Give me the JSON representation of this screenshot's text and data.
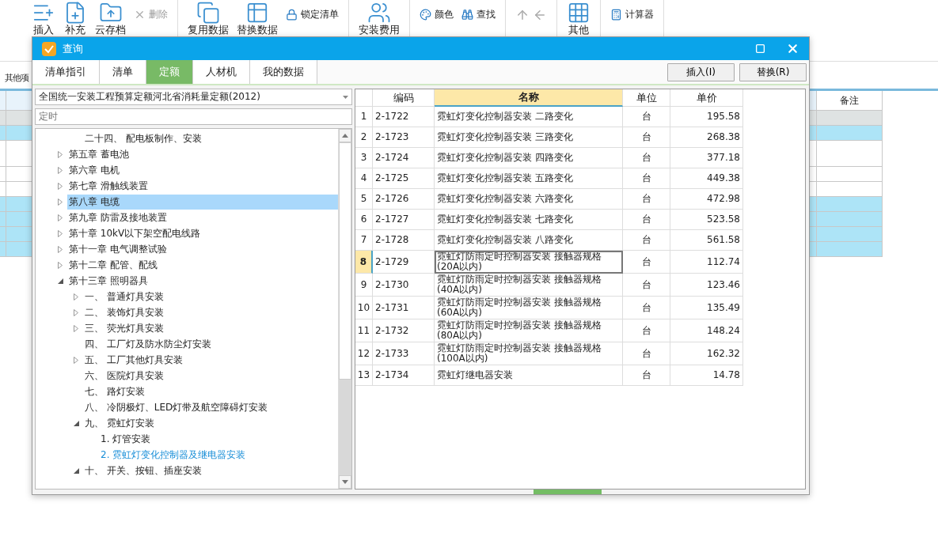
{
  "toolbar": {
    "groups": [
      {
        "items": [
          {
            "kind": "large",
            "label": "插入"
          },
          {
            "kind": "large",
            "label": "补充"
          },
          {
            "kind": "large",
            "label": "云存档"
          },
          {
            "kind": "small",
            "label": "删除",
            "disabled": true
          }
        ]
      },
      {
        "items": [
          {
            "kind": "large",
            "label": "复用数据"
          },
          {
            "kind": "large",
            "label": "替换数据"
          },
          {
            "kind": "small",
            "label": "锁定清单",
            "disabled": false
          }
        ]
      },
      {
        "items": [
          {
            "kind": "large",
            "label": "安装费用"
          }
        ]
      },
      {
        "items": [
          {
            "kind": "small",
            "label": "颜色",
            "disabled": false
          },
          {
            "kind": "small",
            "label": "查找",
            "disabled": false
          }
        ]
      },
      {
        "items": [
          {
            "kind": "arrows"
          }
        ]
      },
      {
        "items": [
          {
            "kind": "large",
            "label": "其他"
          }
        ]
      },
      {
        "items": [
          {
            "kind": "small",
            "label": "计算器",
            "disabled": false
          }
        ]
      }
    ]
  },
  "sheet": {
    "tab": "其他项",
    "column": "备注",
    "rows": [
      {
        "kind": "grey"
      },
      {
        "kind": "blue"
      },
      {
        "kind": "tall"
      },
      {
        "kind": "white"
      },
      {
        "kind": "white"
      },
      {
        "kind": "blue"
      },
      {
        "kind": "blue"
      },
      {
        "kind": "blue"
      },
      {
        "kind": "blue"
      }
    ]
  },
  "dialog": {
    "title": "查询",
    "tabs": [
      {
        "label": "清单指引",
        "selected": false
      },
      {
        "label": "清单",
        "selected": false
      },
      {
        "label": "定额",
        "selected": true
      },
      {
        "label": "人材机",
        "selected": false
      },
      {
        "label": "我的数据",
        "selected": false
      }
    ],
    "buttons": [
      "插入(I)",
      "替换(R)"
    ],
    "library": "全国统一安装工程预算定额河北省消耗量定额(2012)",
    "search": {
      "value": "定时"
    },
    "tree": [
      {
        "children": [
          {
            "label": "二十四、 配电板制作、安装",
            "kind": "leaf",
            "selected": false,
            "active": false
          }
        ]
      },
      {
        "label": "第五章 蓄电池",
        "kind": "branch",
        "expanded": false,
        "selected": false,
        "active": false
      },
      {
        "label": "第六章 电机",
        "kind": "branch",
        "expanded": false,
        "selected": false,
        "active": false
      },
      {
        "label": "第七章 滑触线装置",
        "kind": "branch",
        "expanded": false,
        "selected": false,
        "active": false
      },
      {
        "label": "第八章 电缆",
        "kind": "branch",
        "expanded": false,
        "selected": true,
        "active": false
      },
      {
        "label": "第九章 防雷及接地装置",
        "kind": "branch",
        "expanded": false,
        "selected": false,
        "active": false
      },
      {
        "label": "第十章 10kV以下架空配电线路",
        "kind": "branch",
        "expanded": false,
        "selected": false,
        "active": false
      },
      {
        "label": "第十一章 电气调整试验",
        "kind": "branch",
        "expanded": false,
        "selected": false,
        "active": false
      },
      {
        "label": "第十二章 配管、配线",
        "kind": "branch",
        "expanded": false,
        "selected": false,
        "active": false
      },
      {
        "label": "第十三章 照明器具",
        "kind": "branch",
        "expanded": true,
        "selected": false,
        "active": false,
        "children": [
          {
            "label": "一、 普通灯具安装",
            "kind": "branch",
            "expanded": false,
            "selected": false,
            "active": false
          },
          {
            "label": "二、 装饰灯具安装",
            "kind": "branch",
            "expanded": false,
            "selected": false,
            "active": false
          },
          {
            "label": "三、 荧光灯具安装",
            "kind": "branch",
            "expanded": false,
            "selected": false,
            "active": false
          },
          {
            "label": "四、 工厂灯及防水防尘灯安装",
            "kind": "leaf",
            "selected": false,
            "active": false
          },
          {
            "label": "五、 工厂其他灯具安装",
            "kind": "branch",
            "expanded": false,
            "selected": false,
            "active": false
          },
          {
            "label": "六、 医院灯具安装",
            "kind": "leaf",
            "selected": false,
            "active": false
          },
          {
            "label": "七、 路灯安装",
            "kind": "leaf",
            "selected": false,
            "active": false
          },
          {
            "label": "八、 冷阴极灯、LED灯带及航空障碍灯安装",
            "kind": "leaf",
            "selected": false,
            "active": false
          },
          {
            "label": "九、 霓虹灯安装",
            "kind": "branch",
            "expanded": true,
            "selected": false,
            "active": false,
            "children": [
              {
                "label": "1. 灯管安装",
                "kind": "leaf",
                "selected": false,
                "active": false
              },
              {
                "label": "2. 霓虹灯变化控制器及继电器安装",
                "kind": "leaf",
                "selected": false,
                "active": true
              }
            ]
          },
          {
            "label": "十、 开关、按钮、插座安装",
            "kind": "branch",
            "expanded": true,
            "selected": false,
            "active": false
          }
        ]
      }
    ],
    "table": {
      "columns": [
        "编码",
        "名称",
        "单位",
        "单价"
      ],
      "rows": [
        {
          "index": "1",
          "code": "2-1722",
          "name": "霓虹灯变化控制器安装 二路变化",
          "unit": "台",
          "price": "195.58",
          "selected": false
        },
        {
          "index": "2",
          "code": "2-1723",
          "name": "霓虹灯变化控制器安装 三路变化",
          "unit": "台",
          "price": "268.38",
          "selected": false
        },
        {
          "index": "3",
          "code": "2-1724",
          "name": "霓虹灯变化控制器安装 四路变化",
          "unit": "台",
          "price": "377.18",
          "selected": false
        },
        {
          "index": "4",
          "code": "2-1725",
          "name": "霓虹灯变化控制器安装 五路变化",
          "unit": "台",
          "price": "449.38",
          "selected": false
        },
        {
          "index": "5",
          "code": "2-1726",
          "name": "霓虹灯变化控制器安装 六路变化",
          "unit": "台",
          "price": "472.98",
          "selected": false
        },
        {
          "index": "6",
          "code": "2-1727",
          "name": "霓虹灯变化控制器安装 七路变化",
          "unit": "台",
          "price": "523.58",
          "selected": false
        },
        {
          "index": "7",
          "code": "2-1728",
          "name": "霓虹灯变化控制器安装 八路变化",
          "unit": "台",
          "price": "561.58",
          "selected": false
        },
        {
          "index": "8",
          "code": "2-1729",
          "name": "霓虹灯防雨定时控制器安装 接触器规格(20A以内)",
          "unit": "台",
          "price": "112.74",
          "selected": true
        },
        {
          "index": "9",
          "code": "2-1730",
          "name": "霓虹灯防雨定时控制器安装 接触器规格(40A以内)",
          "unit": "台",
          "price": "123.46",
          "selected": false
        },
        {
          "index": "10",
          "code": "2-1731",
          "name": "霓虹灯防雨定时控制器安装 接触器规格(60A以内)",
          "unit": "台",
          "price": "135.49",
          "selected": false
        },
        {
          "index": "11",
          "code": "2-1732",
          "name": "霓虹灯防雨定时控制器安装 接触器规格(80A以内)",
          "unit": "台",
          "price": "148.24",
          "selected": false
        },
        {
          "index": "12",
          "code": "2-1733",
          "name": "霓虹灯防雨定时控制器安装 接触器规格(100A以内)",
          "unit": "台",
          "price": "162.32",
          "selected": false
        },
        {
          "index": "13",
          "code": "2-1734",
          "name": "霓虹灯继电器安装",
          "unit": "台",
          "price": "14.78",
          "selected": false
        }
      ]
    }
  }
}
